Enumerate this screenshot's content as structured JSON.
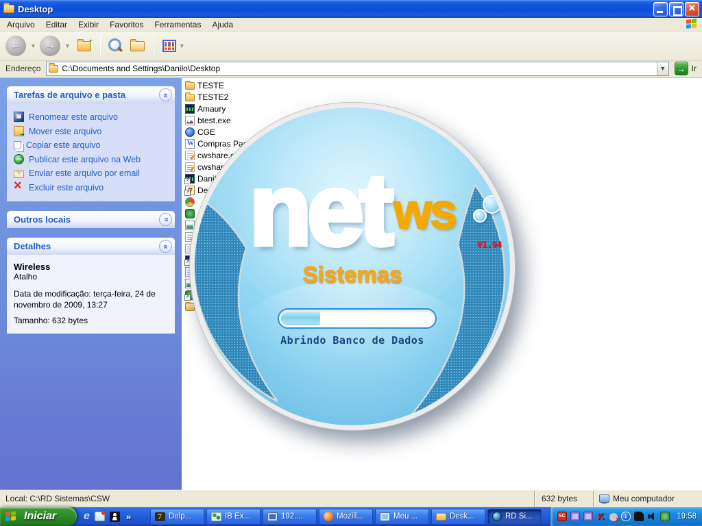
{
  "window": {
    "title": "Desktop"
  },
  "menu": {
    "items": [
      "Arquivo",
      "Editar",
      "Exibir",
      "Favoritos",
      "Ferramentas",
      "Ajuda"
    ]
  },
  "addressbar": {
    "label": "Endereço",
    "path": "C:\\Documents and Settings\\Danilo\\Desktop",
    "go": "Ir"
  },
  "taskpane": {
    "file_tasks": {
      "title": "Tarefas de arquivo e pasta",
      "items": [
        {
          "label": "Renomear este arquivo",
          "icon": "rename-icon"
        },
        {
          "label": "Mover este arquivo",
          "icon": "move-icon"
        },
        {
          "label": "Copiar este arquivo",
          "icon": "copy-icon"
        },
        {
          "label": "Publicar este arquivo na Web",
          "icon": "publish-web-icon"
        },
        {
          "label": "Enviar este arquivo por email",
          "icon": "email-icon"
        },
        {
          "label": "Excluir este arquivo",
          "icon": "delete-icon"
        }
      ]
    },
    "other_places": {
      "title": "Outros locais"
    },
    "details": {
      "title": "Detalhes",
      "file_name": "Wireless",
      "file_kind": "Atalho",
      "modified": "Data de modificação: terça-feira, 24 de novembro de 2009, 13:27",
      "size": "Tamanho: 632 bytes"
    }
  },
  "files": [
    {
      "name": "TESTE",
      "icon": "folder-icon"
    },
    {
      "name": "TESTE2",
      "icon": "folder-icon"
    },
    {
      "name": "Amaury",
      "icon": "app-icon"
    },
    {
      "name": "btest.exe",
      "icon": "chart-file-icon"
    },
    {
      "name": "CGE",
      "icon": "cge-app-icon"
    },
    {
      "name": "Compras Para",
      "icon": "word-doc-icon"
    },
    {
      "name": "cwshare.cf",
      "icon": "config-file-icon"
    },
    {
      "name": "cwshare",
      "icon": "config-file-icon"
    },
    {
      "name": "Danil",
      "icon": "app-shortcut-icon"
    },
    {
      "name": "De",
      "icon": "delphi-shortcut-icon"
    }
  ],
  "splash": {
    "logo_main": "net",
    "logo_suffix": "ws",
    "logo_sub": "Sistemas",
    "version": "V1.04",
    "status_text": "Abrindo Banco de Dados",
    "progress_percent": 25
  },
  "statusbar": {
    "location": "Local: C:\\RD Sistemas\\CSW",
    "size": "632 bytes",
    "zone": "Meu computador"
  },
  "taskbar": {
    "start_label": "Iniciar",
    "quicklaunch_more": "»",
    "tasks": [
      {
        "label": "Delp...",
        "icon": "delphi-icon"
      },
      {
        "label": "IB Ex...",
        "icon": "ibexpert-icon"
      },
      {
        "label": "192....",
        "icon": "remote-desktop-icon"
      },
      {
        "label": "Mozill...",
        "icon": "firefox-icon"
      },
      {
        "label": "Meu ...",
        "icon": "my-computer-icon"
      },
      {
        "label": "Desk...",
        "icon": "folder-icon"
      },
      {
        "label": "RD Si...",
        "icon": "rd-sistemas-icon",
        "active": true
      }
    ],
    "clock": "19:58"
  },
  "colors": {
    "titlebar_blue": "#0d4fd8",
    "taskbar_blue": "#245edb",
    "link_blue": "#215dc6",
    "logo_orange": "#f5a800",
    "version_red": "#ff0f0f",
    "splash_blue": "#53b7e4"
  }
}
